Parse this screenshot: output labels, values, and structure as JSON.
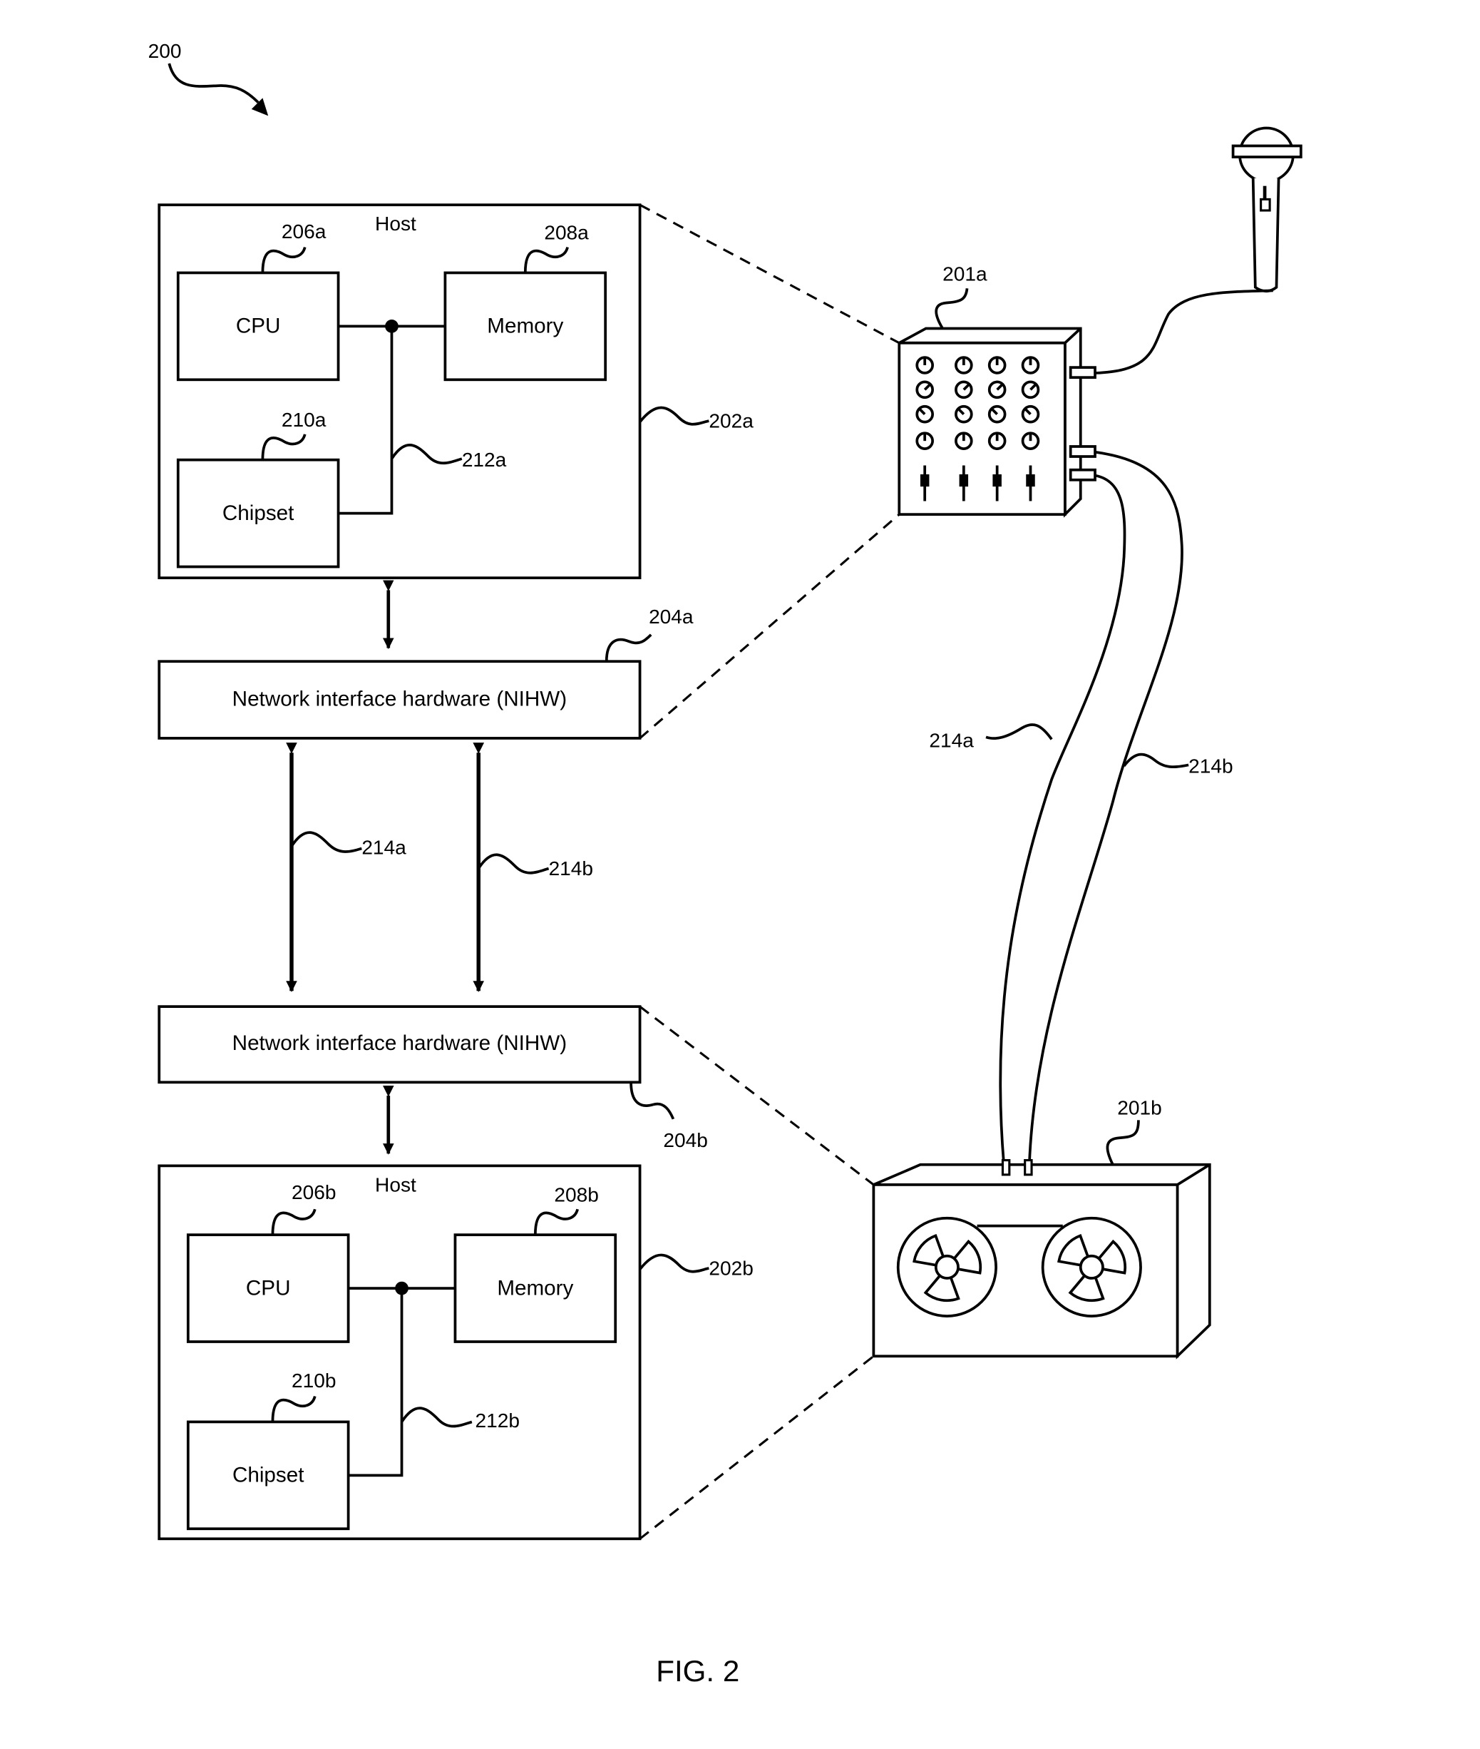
{
  "figure": {
    "ref": "200",
    "caption": "FIG. 2"
  },
  "host_a": {
    "title": "Host",
    "ref": "202a",
    "cpu": {
      "label": "CPU",
      "ref": "206a"
    },
    "memory": {
      "label": "Memory",
      "ref": "208a"
    },
    "chipset": {
      "label": "Chipset",
      "ref": "210a"
    },
    "bus_ref": "212a"
  },
  "nihw_a": {
    "label": "Network interface hardware (NIHW)",
    "ref": "204a"
  },
  "links": {
    "a": "214a",
    "b": "214b"
  },
  "nihw_b": {
    "label": "Network interface hardware (NIHW)",
    "ref": "204b"
  },
  "host_b": {
    "title": "Host",
    "ref": "202b",
    "cpu": {
      "label": "CPU",
      "ref": "206b"
    },
    "memory": {
      "label": "Memory",
      "ref": "208b"
    },
    "chipset": {
      "label": "Chipset",
      "ref": "210b"
    },
    "bus_ref": "212b"
  },
  "device_a": {
    "name": "mixer",
    "ref": "201a"
  },
  "device_b": {
    "name": "tape-deck",
    "ref": "201b"
  },
  "cables": {
    "a": "214a",
    "b": "214b"
  },
  "icons": [
    "microphone-icon",
    "mixer-icon",
    "tape-deck-icon"
  ]
}
